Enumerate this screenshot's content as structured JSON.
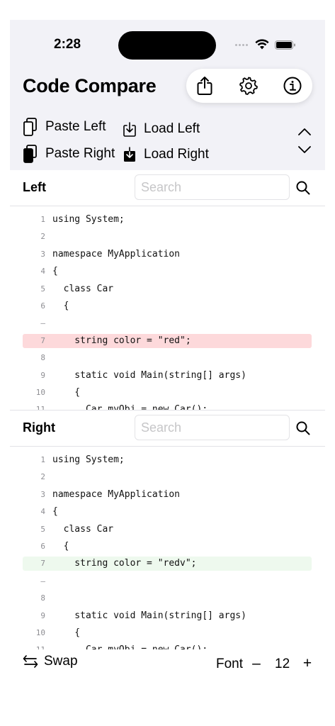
{
  "status": {
    "time": "2:28"
  },
  "app": {
    "title": "Code Compare"
  },
  "actions": {
    "share_icon": "share-icon",
    "settings_icon": "gear-icon",
    "info_icon": "info-icon"
  },
  "toolbar": {
    "paste_left": "Paste Left",
    "load_left": "Load Left",
    "paste_right": "Paste Right",
    "load_right": "Load Right"
  },
  "left": {
    "title": "Left",
    "search_placeholder": "Search",
    "lines": [
      {
        "num": "1",
        "text": "using System;",
        "type": "normal"
      },
      {
        "num": "2",
        "text": "",
        "type": "normal"
      },
      {
        "num": "3",
        "text": "namespace MyApplication",
        "type": "normal"
      },
      {
        "num": "4",
        "text": "{",
        "type": "normal"
      },
      {
        "num": "5",
        "text": "  class Car",
        "type": "normal"
      },
      {
        "num": "6",
        "text": "  {",
        "type": "normal"
      },
      {
        "num": "–",
        "text": "",
        "type": "placeholder"
      },
      {
        "num": "7",
        "text": "    string color = \"red\";",
        "type": "deleted"
      },
      {
        "num": "8",
        "text": "",
        "type": "normal"
      },
      {
        "num": "9",
        "text": "    static void Main(string[] args)",
        "type": "normal"
      },
      {
        "num": "10",
        "text": "    {",
        "type": "normal"
      },
      {
        "num": "11",
        "text": "      Car myObj = new Car();",
        "type": "normal"
      }
    ]
  },
  "right": {
    "title": "Right",
    "search_placeholder": "Search",
    "lines": [
      {
        "num": "1",
        "text": "using System;",
        "type": "normal"
      },
      {
        "num": "2",
        "text": "",
        "type": "normal"
      },
      {
        "num": "3",
        "text": "namespace MyApplication",
        "type": "normal"
      },
      {
        "num": "4",
        "text": "{",
        "type": "normal"
      },
      {
        "num": "5",
        "text": "  class Car",
        "type": "normal"
      },
      {
        "num": "6",
        "text": "  {",
        "type": "normal"
      },
      {
        "num": "7",
        "text": "    string color = \"redv\";",
        "type": "added"
      },
      {
        "num": "–",
        "text": "",
        "type": "placeholder"
      },
      {
        "num": "8",
        "text": "",
        "type": "normal"
      },
      {
        "num": "9",
        "text": "    static void Main(string[] args)",
        "type": "normal"
      },
      {
        "num": "10",
        "text": "    {",
        "type": "normal"
      },
      {
        "num": "11",
        "text": "      Car myObj = new Car();",
        "type": "normal"
      }
    ]
  },
  "bottom": {
    "swap_label": "Swap",
    "font_label": "Font",
    "decrease": "–",
    "font_size": "12",
    "increase": "+"
  },
  "colors": {
    "deleted_bg": "#fdd9db",
    "added_bg": "#eef9ee",
    "toolbar_bg": "#f2f2f7"
  }
}
